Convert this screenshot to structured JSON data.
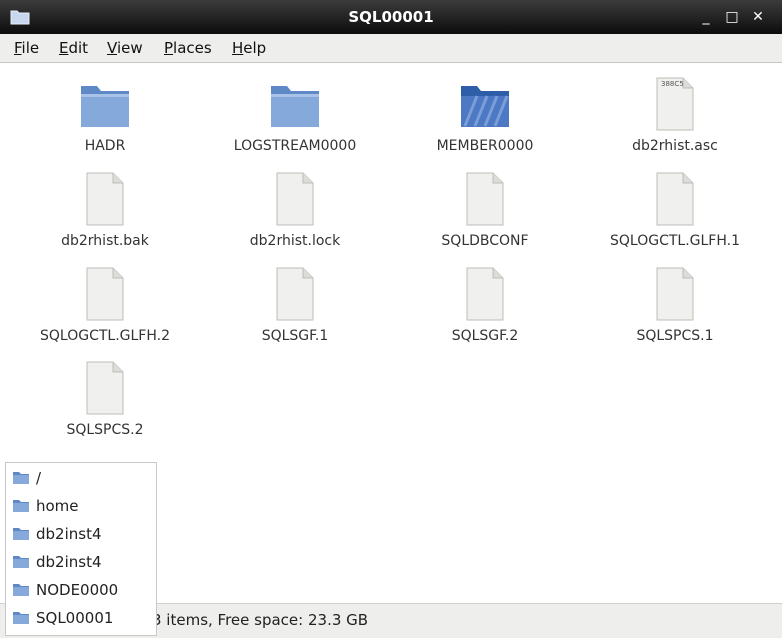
{
  "window": {
    "title": "SQL00001",
    "minimize_glyph": "_",
    "maximize_glyph": "□",
    "close_glyph": "✕"
  },
  "menu": [
    {
      "first": "F",
      "rest": "ile"
    },
    {
      "first": "E",
      "rest": "dit"
    },
    {
      "first": "V",
      "rest": "iew"
    },
    {
      "first": "P",
      "rest": "laces"
    },
    {
      "first": "H",
      "rest": "elp"
    }
  ],
  "files": [
    {
      "name": "HADR",
      "icon": "folder-icon"
    },
    {
      "name": "LOGSTREAM0000",
      "icon": "folder-icon"
    },
    {
      "name": "MEMBER0000",
      "icon": "folder-open-icon"
    },
    {
      "name": "db2rhist.asc",
      "icon": "text-file-icon",
      "preview": "388C5"
    },
    {
      "name": "db2rhist.bak",
      "icon": "file-icon"
    },
    {
      "name": "db2rhist.lock",
      "icon": "file-icon"
    },
    {
      "name": "SQLDBCONF",
      "icon": "file-icon"
    },
    {
      "name": "SQLOGCTL.GLFH.1",
      "icon": "file-icon"
    },
    {
      "name": "SQLOGCTL.GLFH.2",
      "icon": "file-icon"
    },
    {
      "name": "SQLSGF.1",
      "icon": "file-icon"
    },
    {
      "name": "SQLSGF.2",
      "icon": "file-icon"
    },
    {
      "name": "SQLSPCS.1",
      "icon": "file-icon"
    },
    {
      "name": "SQLSPCS.2",
      "icon": "file-icon"
    }
  ],
  "status": {
    "text": "3 items, Free space: 23.3 GB"
  },
  "places": [
    {
      "label": "/"
    },
    {
      "label": "home"
    },
    {
      "label": "db2inst4"
    },
    {
      "label": "db2inst4"
    },
    {
      "label": "NODE0000"
    },
    {
      "label": "SQL00001"
    }
  ],
  "colors": {
    "folder": "#7aa0d6",
    "folder_open": "#4d79c4",
    "file_page": "#f0f0ee"
  }
}
